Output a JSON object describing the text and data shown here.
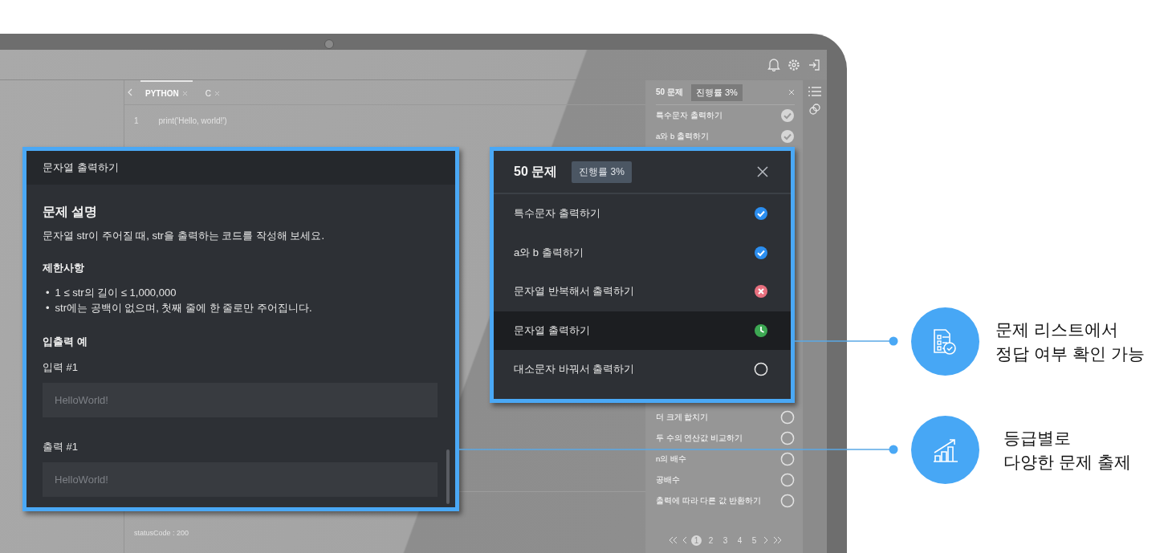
{
  "device_screen": {
    "editor": {
      "tabs": [
        {
          "label": "PYTHON",
          "selected": true
        },
        {
          "label": "C",
          "selected": false
        }
      ],
      "lines": [
        {
          "number": "1",
          "code": "print('Hello, world!')"
        }
      ],
      "output": [
        "statusCode : 200"
      ]
    },
    "problem_list": {
      "title": "50 문제",
      "progress": "진행률 3%",
      "top_items": [
        {
          "title": "특수문자 출력하기",
          "kind": "correct"
        },
        {
          "title": "a와 b 출력하기",
          "kind": "correct"
        }
      ],
      "bottom_items": [
        {
          "title": "더 크게 합치기",
          "kind": "unsolved"
        },
        {
          "title": "두 수의 연산값 비교하기",
          "kind": "unsolved"
        },
        {
          "title": "n의 배수",
          "kind": "unsolved"
        },
        {
          "title": "공배수",
          "kind": "unsolved"
        },
        {
          "title": "출력에 따라 다른 값 반환하기",
          "kind": "unsolved"
        }
      ],
      "pages": [
        {
          "label": "1",
          "selected": true
        },
        {
          "label": "2",
          "selected": false
        },
        {
          "label": "3",
          "selected": false
        },
        {
          "label": "4",
          "selected": false
        },
        {
          "label": "5",
          "selected": false
        }
      ]
    }
  },
  "problem_card": {
    "title": "문자열 출력하기",
    "heading": "문제 설명",
    "description": "문자열 str이 주어질 때, str을 출력하는 코드를 작성해 보세요.",
    "constraints_heading": "제한사항",
    "constraints": [
      {
        "bullet": "•",
        "text": "1 ≤ str의 길이 ≤ 1,000,000"
      },
      {
        "bullet": "•",
        "text": "str에는 공백이 없으며, 첫째 줄에 한 줄로만 주어집니다."
      }
    ],
    "examples_heading": "입출력 예",
    "examples": [
      {
        "label": "입력 #1",
        "value": "HelloWorld!"
      },
      {
        "label": "출력 #1",
        "value": "HelloWorld!"
      }
    ]
  },
  "list_card": {
    "title": "50 문제",
    "progress": "진행률 3%",
    "items": [
      {
        "title": "특수문자 출력하기",
        "kind": "correct",
        "selected": false
      },
      {
        "title": "a와 b 출력하기",
        "kind": "correct",
        "selected": false
      },
      {
        "title": "문자열 반복해서 출력하기",
        "kind": "wrong",
        "selected": false
      },
      {
        "title": "문자열 출력하기",
        "kind": "in_progress",
        "selected": true
      },
      {
        "title": "대소문자 바꿔서 출력하기",
        "kind": "unsolved",
        "selected": false
      }
    ]
  },
  "features": [
    {
      "kind": "checklist",
      "lines": [
        "문제 리스트에서",
        "정답 여부 확인 가능"
      ]
    },
    {
      "kind": "chart",
      "lines": [
        "등급별로",
        "다양한 문제 출제"
      ]
    }
  ]
}
